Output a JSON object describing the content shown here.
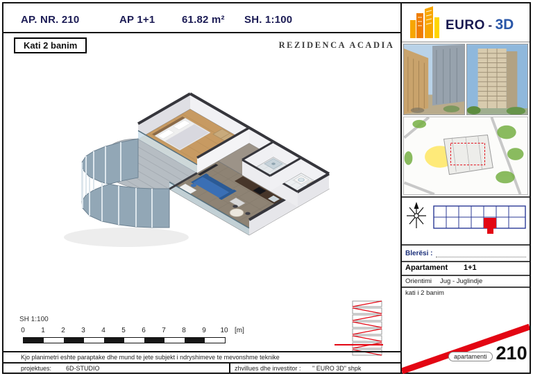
{
  "header": {
    "ap_nr": "AP. NR. 210",
    "ap_type": "AP 1+1",
    "area": "61.82 m²",
    "scale": "SH. 1:100",
    "floor_box": "Kati 2 banim",
    "project_title": "REZIDENCA ACADIA"
  },
  "scalebar": {
    "label": "SH  1:100",
    "ticks": [
      "0",
      "1",
      "2",
      "3",
      "4",
      "5",
      "6",
      "7",
      "8",
      "9",
      "10"
    ],
    "unit": "[m]"
  },
  "footer": {
    "disclaimer": "Kjo planimetri eshte paraptake dhe mund te jete subjekt i ndryshimeve te mevonshme teknike",
    "designer_label": "projektues:",
    "designer_name": "6D-STUDIO",
    "developer_label": "zhvillues dhe investitor :",
    "developer_name": "\" EURO 3D\" shpk"
  },
  "sidebar": {
    "logo": {
      "euro": "EURO",
      "dash": "-",
      "threed": "3D"
    },
    "info": {
      "buyer_label": "Blerësi :",
      "apartment_label": "Apartament",
      "apartment_value": "1+1",
      "orientation_label": "Orientimi",
      "orientation_value": "Jug - Juglindje",
      "floor_note": "kati i 2 banim"
    },
    "badge": {
      "label": "apartamenti",
      "number": "210"
    }
  },
  "colors": {
    "accent_red": "#e30613",
    "navy": "#1c1c55",
    "blue": "#2a57a8",
    "orange": "#f39200"
  }
}
